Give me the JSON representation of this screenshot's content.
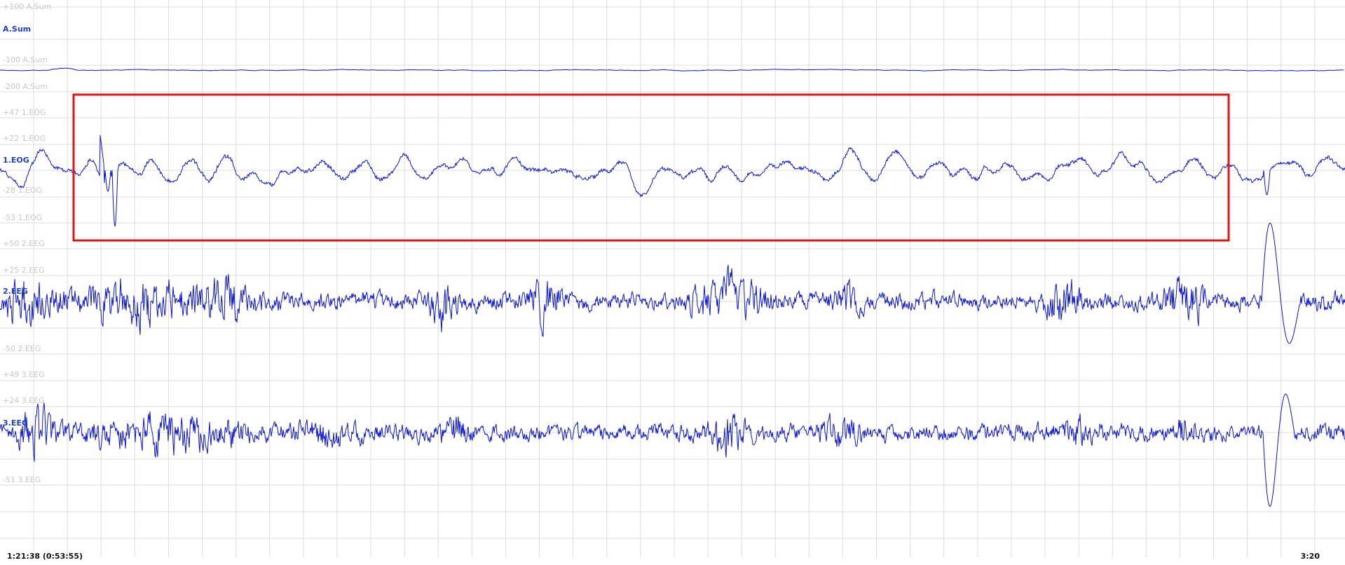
{
  "colors": {
    "trace": "#0a14d6",
    "grid": "#dcdcdc",
    "scale_label": "#c8c8c8",
    "channel_label": "#1f3fd0",
    "highlight_box": "#e01515"
  },
  "channels": [
    {
      "name": "A.Sum",
      "scale_labels": [
        "+100 A.Sum",
        "-100 A.Sum",
        "-200 A.Sum"
      ]
    },
    {
      "name": "1.EOG",
      "scale_labels": [
        "+47 1.EOG",
        "+22 1.EOG",
        "-28 1.EOG",
        "-53 1.EOG"
      ]
    },
    {
      "name": "2.EEG",
      "scale_labels": [
        "+50 2.EEG",
        "+25 2.EEG",
        "-50 2.EEG"
      ]
    },
    {
      "name": "3.EEG",
      "scale_labels": [
        "+49 3.EEG",
        "+24 3.EEG",
        "-51 3.EEG"
      ]
    }
  ],
  "footer": {
    "start_time": "1:21:38 (0:53:55)",
    "end_time": "3:20"
  },
  "chart_data": {
    "type": "line",
    "title": "",
    "series": [
      {
        "name": "A.Sum",
        "unit_ticks": [
          100,
          -100,
          -200
        ]
      },
      {
        "name": "1.EOG",
        "unit_ticks": [
          47,
          22,
          -28,
          -53
        ]
      },
      {
        "name": "2.EEG",
        "unit_ticks": [
          50,
          25,
          -50
        ]
      },
      {
        "name": "3.EEG",
        "unit_ticks": [
          49,
          24,
          -51
        ]
      }
    ],
    "grid": true,
    "highlight": "red rectangle around 1.EOG channel segment"
  }
}
